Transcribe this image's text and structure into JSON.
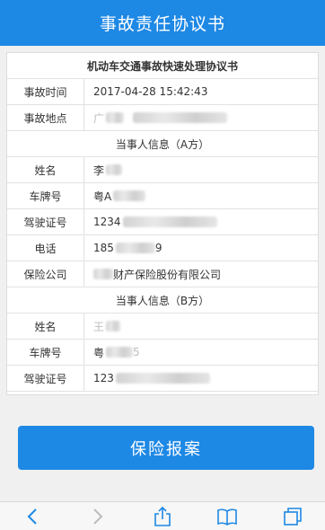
{
  "header": {
    "title": "事故责任协议书"
  },
  "table": {
    "title": "机动车交通事故快速处理协议书",
    "accident_time": {
      "label": "事故时间",
      "value": "2017-04-28 15:42:43"
    },
    "accident_place": {
      "label": "事故地点",
      "value_prefix": "广"
    },
    "party_a": {
      "heading": "当事人信息（A方）",
      "name": {
        "label": "姓名",
        "value_prefix": "李"
      },
      "plate": {
        "label": "车牌号",
        "value_prefix": "粤A"
      },
      "license": {
        "label": "驾驶证号",
        "value_prefix": "1234"
      },
      "phone": {
        "label": "电话",
        "value_prefix": "185",
        "value_suffix": "9"
      },
      "insurer": {
        "label": "保险公司",
        "value_suffix": "财产保险股份有限公司"
      }
    },
    "party_b": {
      "heading": "当事人信息（B方）",
      "name": {
        "label": "姓名",
        "value_prefix": "王"
      },
      "plate": {
        "label": "车牌号",
        "value_prefix": "粤",
        "value_suffix": "5"
      },
      "license": {
        "label": "驾驶证号",
        "value_prefix": "123"
      }
    }
  },
  "actions": {
    "report_label": "保险报案"
  },
  "toolbar": {
    "items": [
      {
        "icon": "back-icon"
      },
      {
        "icon": "forward-icon"
      },
      {
        "icon": "share-icon"
      },
      {
        "icon": "bookmarks-icon"
      },
      {
        "icon": "tabs-icon"
      }
    ]
  },
  "colors": {
    "accent": "#1e88e5",
    "border": "#e2e2e2",
    "text": "#333333"
  }
}
